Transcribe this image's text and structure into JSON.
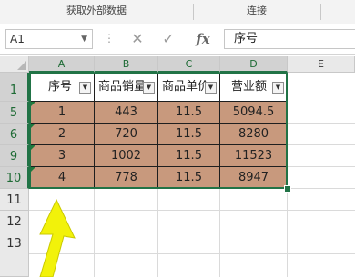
{
  "ribbon": {
    "group1": "获取外部数据",
    "group2": "连接"
  },
  "formula_bar": {
    "name_box": "A1",
    "name_box_dropdown": "▼",
    "dots": "⋮",
    "cancel_icon": "✕",
    "confirm_icon": "✓",
    "fx_label": "fx",
    "formula": "序号"
  },
  "columns": [
    "A",
    "B",
    "C",
    "D",
    "E"
  ],
  "rows": [
    "1",
    "5",
    "6",
    "9",
    "10",
    "11",
    "12",
    "13"
  ],
  "table": {
    "headers": [
      "序号",
      "商品销量",
      "商品单价",
      "营业额"
    ],
    "filter_glyph": "▼",
    "rows": [
      [
        "1",
        "443",
        "11.5",
        "5094.5"
      ],
      [
        "2",
        "720",
        "11.5",
        "8280"
      ],
      [
        "3",
        "1002",
        "11.5",
        "11523"
      ],
      [
        "4",
        "778",
        "11.5",
        "8947"
      ]
    ]
  },
  "colors": {
    "accent_green": "#217346",
    "data_fill": "#c8997d",
    "arrow": "#f2f20a"
  },
  "annotation": {
    "icon": "arrow-icon",
    "pointing": "up"
  }
}
